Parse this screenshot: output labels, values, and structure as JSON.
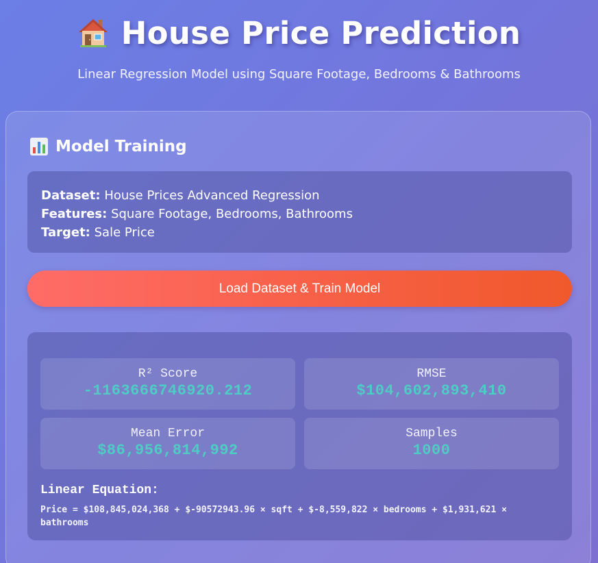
{
  "header": {
    "icon": "house-icon",
    "title": "House Price Prediction",
    "subtitle": "Linear Regression Model using Square Footage, Bedrooms & Bathrooms"
  },
  "training": {
    "icon": "bar-chart-icon",
    "section_title": "Model Training",
    "info": {
      "dataset_label": "Dataset:",
      "dataset_value": "House Prices Advanced Regression",
      "features_label": "Features:",
      "features_value": "Square Footage, Bedrooms, Bathrooms",
      "target_label": "Target:",
      "target_value": "Sale Price"
    },
    "train_button_label": "Load Dataset & Train Model"
  },
  "results": {
    "metrics": [
      {
        "label": "R² Score",
        "value": "-1163666746920.212"
      },
      {
        "label": "RMSE",
        "value": "$104,602,893,410"
      },
      {
        "label": "Mean Error",
        "value": "$86,956,814,992"
      },
      {
        "label": "Samples",
        "value": "1000"
      }
    ],
    "equation_title": "Linear Equation:",
    "equation": "Price = $108,845,024,368 + $-90572943.96 × sqft + $-8,559,822 × bedrooms + $1,931,621 × bathrooms"
  },
  "colors": {
    "accent_value": "#4ecdc4",
    "button_start": "#ff6c68",
    "button_end": "#f0592b"
  }
}
